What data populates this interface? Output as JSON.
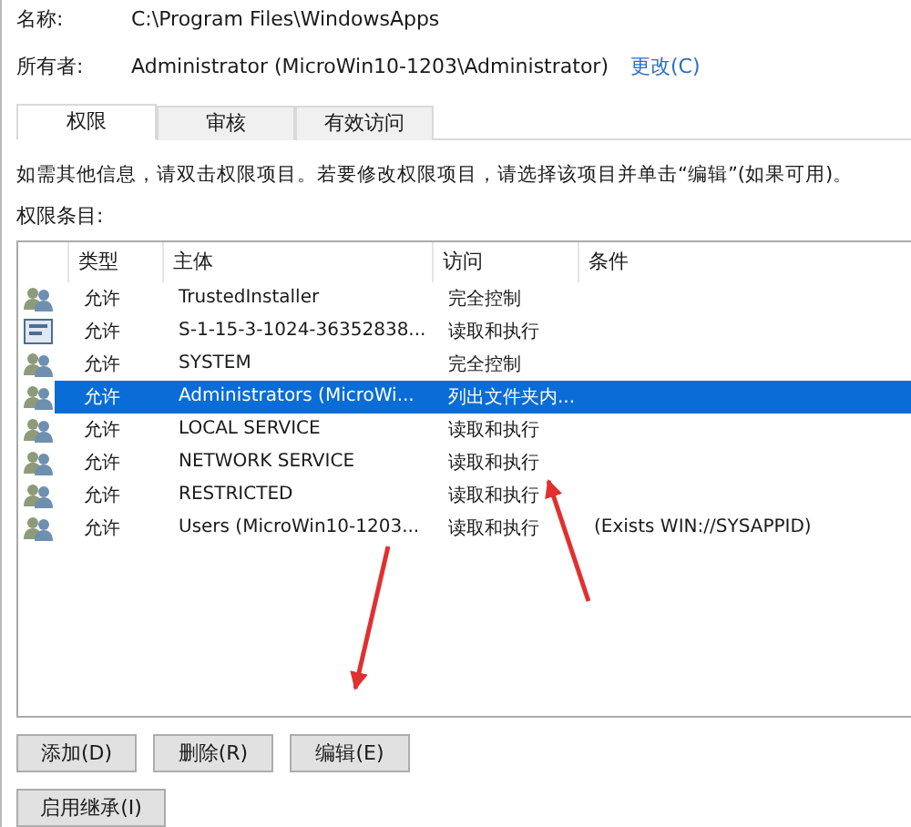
{
  "properties": {
    "name_label": "名称:",
    "name_value": "C:\\Program Files\\WindowsApps",
    "owner_label": "所有者:",
    "owner_value": "Administrator (MicroWin10-1203\\Administrator)",
    "owner_change": "更改(C)"
  },
  "tabs": [
    {
      "label": "权限",
      "selected": true
    },
    {
      "label": "审核",
      "selected": false
    },
    {
      "label": "有效访问",
      "selected": false
    }
  ],
  "info_text": "如需其他信息，请双击权限项目。若要修改权限项目，请选择该项目并单击“编辑”(如果可用)。",
  "list_label": "权限条目:",
  "table": {
    "columns": [
      "类型",
      "主体",
      "访问",
      "条件"
    ],
    "rows": [
      {
        "kind": "group",
        "type": "允许",
        "principal": "TrustedInstaller",
        "access": "完全控制",
        "selected": false
      },
      {
        "kind": "package",
        "type": "允许",
        "principal": "S-1-15-3-1024-36352838...",
        "access": "读取和执行",
        "selected": false
      },
      {
        "kind": "group",
        "type": "允许",
        "principal": "SYSTEM",
        "access": "完全控制",
        "selected": false
      },
      {
        "kind": "group",
        "type": "允许",
        "principal": "Administrators (MicroWi...",
        "access": "列出文件夹内...",
        "selected": true
      },
      {
        "kind": "group",
        "type": "允许",
        "principal": "LOCAL SERVICE",
        "access": "读取和执行",
        "selected": false
      },
      {
        "kind": "group",
        "type": "允许",
        "principal": "NETWORK SERVICE",
        "access": "读取和执行",
        "selected": false
      },
      {
        "kind": "group",
        "type": "允许",
        "principal": "RESTRICTED",
        "access": "读取和执行",
        "selected": false
      },
      {
        "kind": "group",
        "type": "允许",
        "principal": "Users (MicroWin10-1203...",
        "access": "读取和执行",
        "condition": "(Exists WIN://SYSAPPID)",
        "selected": false
      }
    ]
  },
  "buttons": [
    "添加(D)",
    "删除(R)",
    "编辑(E)"
  ],
  "inherit_button": "启用继承(I)"
}
